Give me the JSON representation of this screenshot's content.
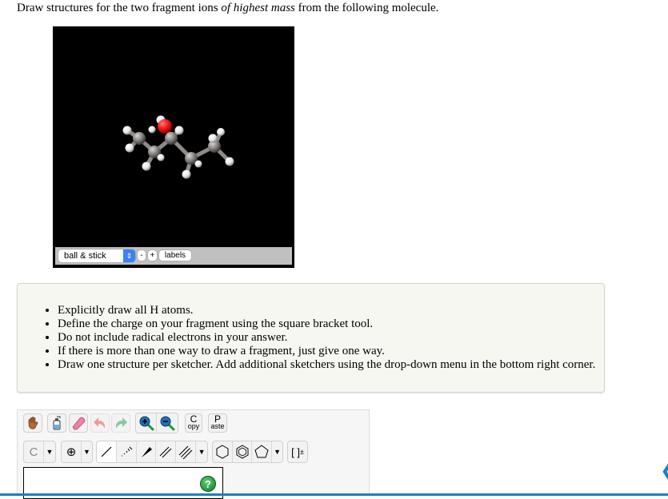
{
  "question": {
    "prefix": "Draw structures for the two fragment ions ",
    "emphasis": "of highest mass",
    "suffix": " from the following molecule."
  },
  "viewer": {
    "molecule_description": "3D ball-and-stick model: carbon atoms (gray), oxygen atom (red), hydrogen atoms (white)",
    "atom_colors": {
      "carbon": "#8e8a88",
      "oxygen": "#ff1a1a",
      "hydrogen": "#f2f2f2"
    },
    "style_select": {
      "value": "ball & stick",
      "arrows": "⇕"
    },
    "zoom_out_label": "-",
    "zoom_in_label": "+",
    "labels_button": "labels"
  },
  "instructions": [
    "Explicitly draw all H atoms.",
    "Define the charge on your fragment using the square bracket tool.",
    "Do not include radical electrons in your answer.",
    "If there is more than one way to draw a fragment, just give one way.",
    "Draw one structure per sketcher. Add additional sketchers using the drop-down menu in the bottom right corner."
  ],
  "sketcher": {
    "toolbar_row1": {
      "hand": "hand-tool",
      "bottle": "lone-pair-tool",
      "eraser": "eraser-tool",
      "undo": "undo",
      "redo": "redo",
      "zoom_in": "zoom-in",
      "zoom_out": "zoom-out",
      "copy": {
        "big": "C",
        "small": "opy"
      },
      "paste": {
        "big": "P",
        "small": "aste"
      }
    },
    "toolbar_row2": {
      "atom_label": "C",
      "charge_label": "⊕",
      "caret": "▼",
      "bracket_label": "[ ]",
      "bracket_sup": "±"
    },
    "help_label": "?"
  },
  "nav": {
    "collapse_arrow": "❮"
  },
  "colors": {
    "accent": "#1b7fc4",
    "help_green": "#1a9a3a"
  }
}
